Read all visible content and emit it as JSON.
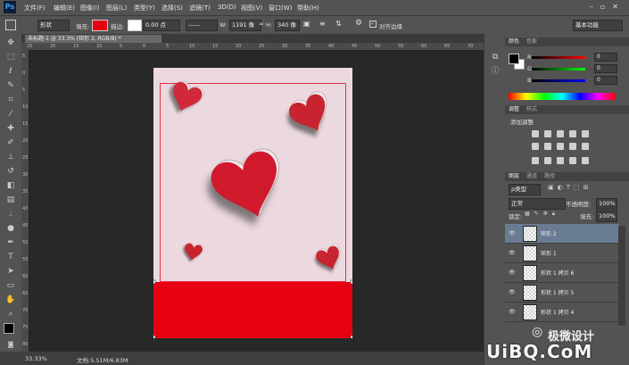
{
  "menubar": {
    "logo": "Ps",
    "items": [
      "文件(F)",
      "编辑(E)",
      "图像(I)",
      "图层(L)",
      "类型(Y)",
      "选择(S)",
      "滤镜(T)",
      "3D(D)",
      "视图(V)",
      "窗口(W)",
      "帮助(H)"
    ]
  },
  "optbar": {
    "shape_mode": "形状",
    "fill_label": "填充:",
    "fill_color": "#e60012",
    "stroke_label": "描边:",
    "stroke_width": "0.00 点",
    "w_label": "W:",
    "w_value": "1191 像",
    "h_label": "H:",
    "h_value": "340 像",
    "align_edges_label": "对齐边缘",
    "workspace": "基本功能"
  },
  "document": {
    "tab_title": "未标题-1 @ 33.3% (矩形 2, RGB/8) *",
    "canvas_bg": "#ecd9df",
    "banner_color": "#e60012"
  },
  "rulers": {
    "h_ticks": [
      "25",
      "20",
      "15",
      "10",
      "5",
      "0",
      "5",
      "10",
      "15",
      "20",
      "25",
      "30",
      "35",
      "40",
      "45",
      "50",
      "55",
      "60",
      "65",
      "70"
    ],
    "v_ticks": [
      "5",
      "0",
      "5",
      "10",
      "15",
      "20",
      "25",
      "30",
      "35",
      "40",
      "45",
      "50",
      "55",
      "60",
      "65",
      "70",
      "75",
      "80"
    ]
  },
  "status": {
    "zoom": "33.33%",
    "doc_info": "文档:5.51M/6.83M"
  },
  "color_panel": {
    "tabs": [
      "颜色",
      "色板"
    ],
    "channels": [
      {
        "label": "R",
        "value": "0"
      },
      {
        "label": "G",
        "value": "0"
      },
      {
        "label": "B",
        "value": "0"
      }
    ]
  },
  "adjust_panel": {
    "tabs": [
      "调整",
      "样式"
    ],
    "title": "添加调整"
  },
  "layers_panel": {
    "tabs": [
      "图层",
      "通道",
      "路径"
    ],
    "filter_label": "ρ类型",
    "blend_mode": "正常",
    "opacity_label": "不透明度:",
    "opacity_value": "100%",
    "lock_label": "锁定:",
    "fill_label": "填充:",
    "fill_value": "100%",
    "layers": [
      {
        "name": "矩形 2",
        "selected": true
      },
      {
        "name": "矩形 1",
        "selected": false
      },
      {
        "name": "形状 1 拷贝 6",
        "selected": false
      },
      {
        "name": "形状 1 拷贝 5",
        "selected": false
      },
      {
        "name": "形状 1 拷贝 4",
        "selected": false
      }
    ]
  },
  "watermark": {
    "text1": "极微设计",
    "text2": "UiBQ.CoM"
  },
  "hearts": [
    {
      "id": "heart-top-left",
      "color": "#d0293a"
    },
    {
      "id": "heart-top-right",
      "color": "#c8242f"
    },
    {
      "id": "heart-center",
      "color": "#d01a2c"
    },
    {
      "id": "heart-small-left",
      "color": "#c8242f"
    },
    {
      "id": "heart-small-right",
      "color": "#c8242f"
    }
  ]
}
